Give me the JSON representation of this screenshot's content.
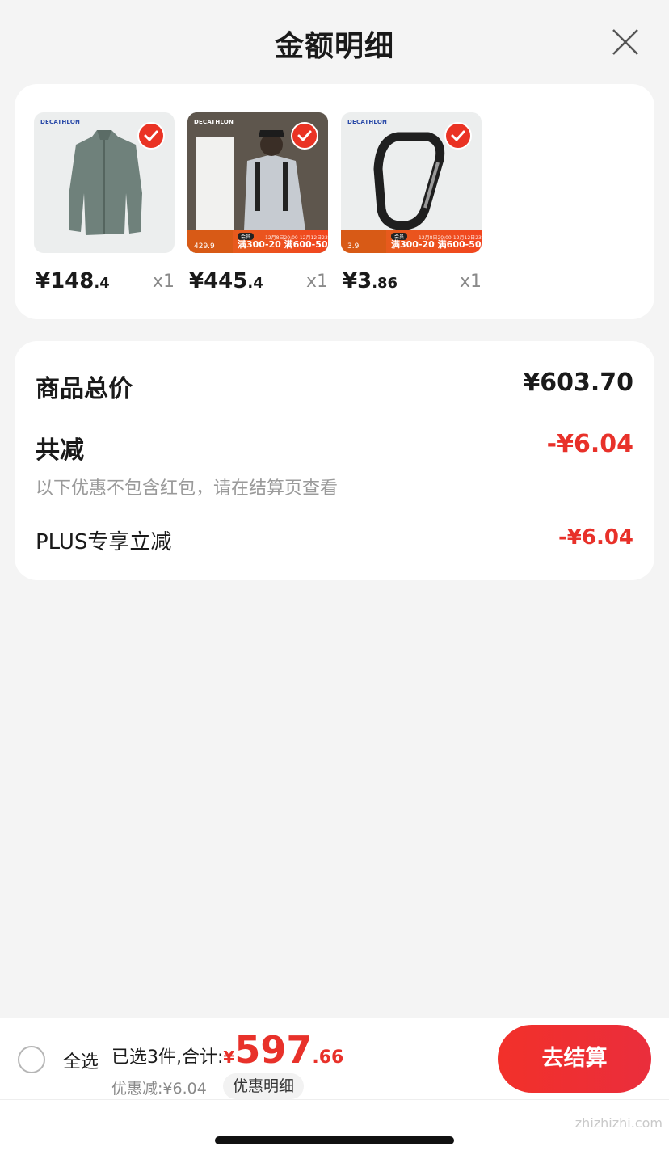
{
  "header": {
    "title": "金额明细"
  },
  "products": [
    {
      "brand": "DECATHLON",
      "price_int": "¥148",
      "price_dec": ".4",
      "qty": "x1",
      "selected": true,
      "promo": null
    },
    {
      "brand": "DECATHLON",
      "price_int": "¥445",
      "price_dec": ".4",
      "qty": "x1",
      "selected": true,
      "promo": {
        "price": "429.9",
        "tag": "会员",
        "text": "满300-20 满600-50",
        "date": "12月8日20:00-12月12日23:59"
      }
    },
    {
      "brand": "DECATHLON",
      "price_int": "¥3",
      "price_dec": ".86",
      "qty": "x1",
      "selected": true,
      "promo": {
        "price": "3.9",
        "tag": "会员",
        "text": "满300-20 满600-50",
        "date": "12月8日20:00-12月12日23:59"
      }
    }
  ],
  "summary": {
    "total_label": "商品总价",
    "total_value": "¥603.70",
    "reduce_label": "共减",
    "reduce_value": "-¥6.04",
    "note": "以下优惠不包含红包，请在结算页查看",
    "plus_label": "PLUS专享立减",
    "plus_value": "-¥6.04"
  },
  "bottom": {
    "select_all": "全选",
    "total_label": "已选3件,合计:",
    "total_yen": "¥",
    "total_int": "597",
    "total_dec": ".66",
    "discount": "优惠减:¥6.04",
    "detail_button": "优惠明细",
    "checkout_button": "去结算"
  },
  "watermark": "zhizhizhi.com",
  "colors": {
    "accent_red": "#e8312a",
    "background": "#f4f4f4",
    "card": "#ffffff"
  }
}
